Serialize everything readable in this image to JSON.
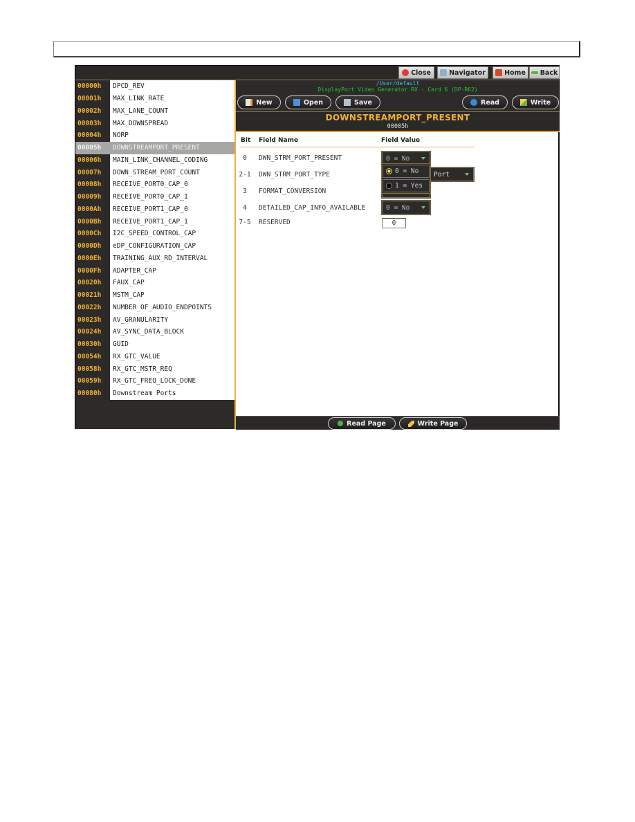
{
  "topbar": {
    "close_label": "Close",
    "navigator_label": "Navigator",
    "home_label": "Home",
    "back_label": "Back"
  },
  "info": {
    "path": "/User/default",
    "device": "DisplayPort Video Generator RX - Card 6  (DP-R62)"
  },
  "toolbar": {
    "new_label": "New",
    "open_label": "Open",
    "save_label": "Save",
    "read_label": "Read",
    "write_label": "Write"
  },
  "register": {
    "title": "DOWNSTREAMPORT_PRESENT",
    "address": "00005h"
  },
  "sidebar": {
    "items": [
      {
        "addr": "00000h",
        "name": "DPCD_REV"
      },
      {
        "addr": "00001h",
        "name": "MAX_LINK_RATE"
      },
      {
        "addr": "00002h",
        "name": "MAX_LANE_COUNT"
      },
      {
        "addr": "00003h",
        "name": "MAX_DOWNSPREAD"
      },
      {
        "addr": "00004h",
        "name": "NORP"
      },
      {
        "addr": "00005h",
        "name": "DOWNSTREAMPORT_PRESENT",
        "selected": true
      },
      {
        "addr": "00006h",
        "name": "MAIN_LINK_CHANNEL_CODING"
      },
      {
        "addr": "00007h",
        "name": "DOWN_STREAM_PORT_COUNT"
      },
      {
        "addr": "00008h",
        "name": "RECEIVE_PORT0_CAP_0"
      },
      {
        "addr": "00009h",
        "name": "RECEIVE_PORT0_CAP_1"
      },
      {
        "addr": "0000Ah",
        "name": "RECEIVE_PORT1_CAP_0"
      },
      {
        "addr": "0000Bh",
        "name": "RECEIVE_PORT1_CAP_1"
      },
      {
        "addr": "0000Ch",
        "name": "I2C_SPEED_CONTROL_CAP"
      },
      {
        "addr": "0000Dh",
        "name": "eDP_CONFIGURATION_CAP"
      },
      {
        "addr": "0000Eh",
        "name": "TRAINING_AUX_RD_INTERVAL"
      },
      {
        "addr": "0000Fh",
        "name": "ADAPTER_CAP"
      },
      {
        "addr": "00020h",
        "name": "FAUX_CAP"
      },
      {
        "addr": "00021h",
        "name": "MSTM_CAP"
      },
      {
        "addr": "00022h",
        "name": "NUMBER_OF_AUDIO_ENDPOINTS"
      },
      {
        "addr": "00023h",
        "name": "AV_GRANULARITY"
      },
      {
        "addr": "00024h",
        "name": "AV_SYNC_DATA_BLOCK"
      },
      {
        "addr": "00030h",
        "name": "GUID"
      },
      {
        "addr": "00054h",
        "name": "RX_GTC_VALUE"
      },
      {
        "addr": "00058h",
        "name": "RX_GTC_MSTR_REQ"
      },
      {
        "addr": "00059h",
        "name": "RX_GTC_FREQ_LOCK_DONE"
      },
      {
        "addr": "00080h",
        "name": "Downstream Ports"
      }
    ]
  },
  "fields": {
    "headers": {
      "bit": "Bit",
      "name": "Field Name",
      "value": "Field Value"
    },
    "rows": [
      {
        "bit": "0",
        "name": "DWN_STRM_PORT_PRESENT",
        "value": "0 = No"
      },
      {
        "bit": "2-1",
        "name": "DWN_STRM_PORT_TYPE",
        "value": "Port"
      },
      {
        "bit": "3",
        "name": "FORMAT_CONVERSION",
        "value": ""
      },
      {
        "bit": "4",
        "name": "DETAILED_CAP_INFO_AVAILABLE",
        "value": "0 = No"
      },
      {
        "bit": "7-5",
        "name": "RESERVED",
        "value": "0"
      }
    ],
    "dropdown_options": [
      {
        "label": "0 = No",
        "selected": true
      },
      {
        "label": "1 = Yes",
        "selected": false
      }
    ]
  },
  "bottombar": {
    "read_page_label": "Read Page",
    "write_page_label": "Write Page"
  },
  "colors": {
    "accent": "#f0b030",
    "background": "#2d2a2a",
    "path_text": "#3cc0e0",
    "device_text": "#30c030"
  }
}
